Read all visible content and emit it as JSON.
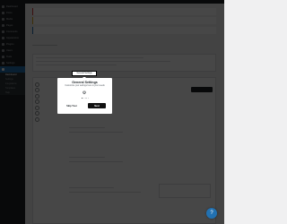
{
  "sidebar": {
    "items": [
      {
        "label": "Dashboard"
      },
      {
        "label": "Posts"
      },
      {
        "label": "Media"
      },
      {
        "label": "Pages"
      },
      {
        "label": "Comments"
      },
      {
        "label": "Appearance"
      },
      {
        "label": "Plugins"
      },
      {
        "label": "Users"
      },
      {
        "label": "Tools"
      },
      {
        "label": "Settings"
      }
    ],
    "sub_items": [
      {
        "label": "Dashboard",
        "current": true
      },
      {
        "label": "Settings"
      },
      {
        "label": "Integrations"
      },
      {
        "label": "Templates"
      },
      {
        "label": "Help"
      }
    ]
  },
  "tour": {
    "tooltip_label": "General Settings",
    "title": "General Settings",
    "subtitle": "Customize your settings here to your needs",
    "icon": "gear-icon",
    "step_dots": 4,
    "active_dot": 0,
    "skip_label": "Skip Tour",
    "next_label": "Next"
  },
  "help_button": {
    "icon": "question-icon",
    "glyph": "?"
  }
}
